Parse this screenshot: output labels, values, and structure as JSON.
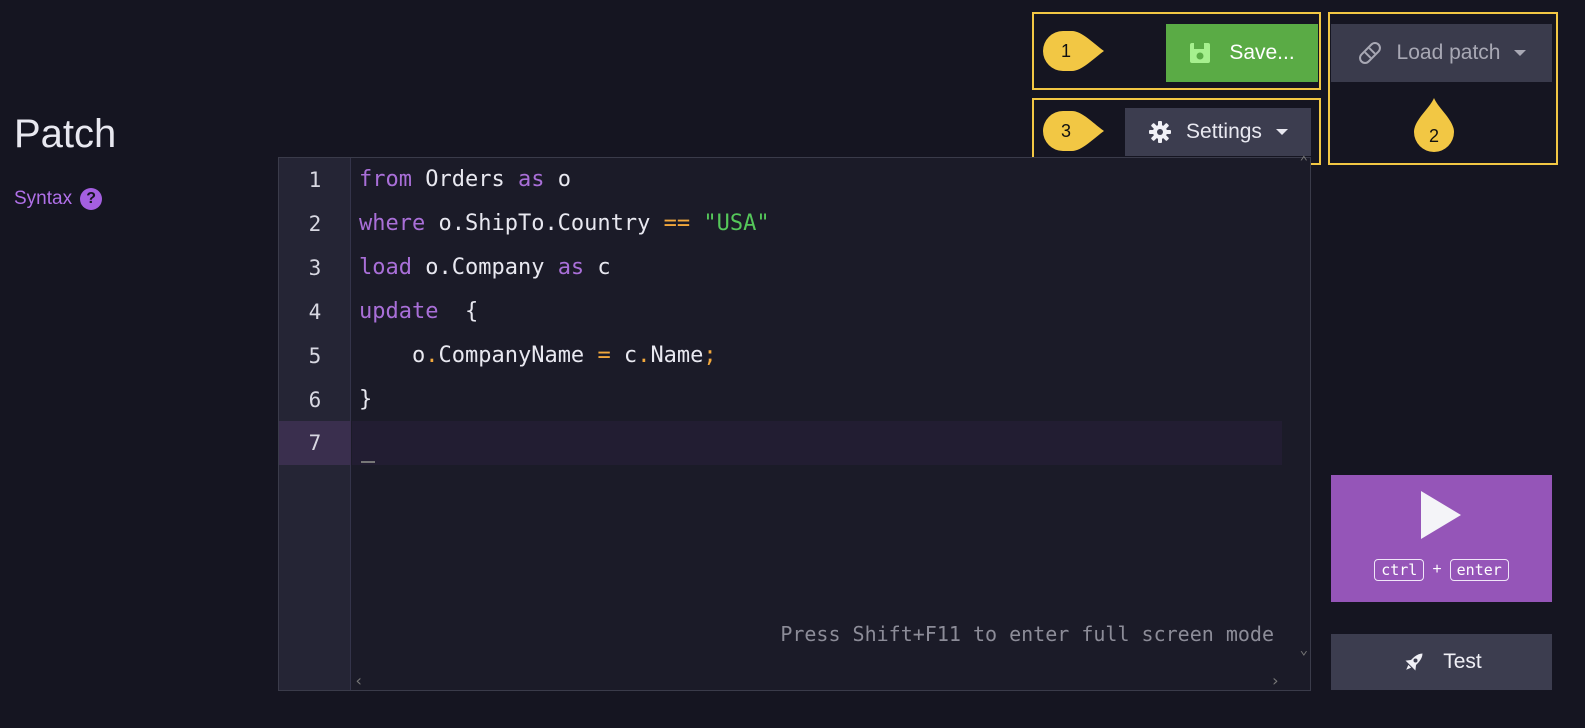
{
  "page": {
    "title": "Patch"
  },
  "syntax": {
    "label": "Syntax",
    "help": "?"
  },
  "callouts": [
    "1",
    "2",
    "3"
  ],
  "toolbar": {
    "save_label": "Save...",
    "load_label": "Load patch",
    "settings_label": "Settings"
  },
  "editor": {
    "line_numbers": [
      "1",
      "2",
      "3",
      "4",
      "5",
      "6",
      "7"
    ],
    "lines": [
      {
        "kw": "from",
        "rest": " Orders ",
        "kw2": "as",
        "tail": " o"
      },
      {
        "kw": "where",
        "rest": " o.ShipTo.Country ",
        "op": "==",
        "str": " \"USA\""
      },
      {
        "kw": "load",
        "rest": " o.Company ",
        "kw2": "as",
        "tail": " c"
      },
      {
        "kw": "update",
        "rest": "  {"
      },
      {
        "pre": "    o",
        "dot1": ".",
        "mid": "CompanyName ",
        "op": "=",
        "mid2": " c",
        "dot2": ".",
        "end": "Name",
        "semi": ";"
      },
      {
        "rest": "}"
      },
      {
        "rest": ""
      }
    ],
    "hint": "Press Shift+F11 to enter full screen mode"
  },
  "run": {
    "key1": "ctrl",
    "plus": "+",
    "key2": "enter"
  },
  "test": {
    "label": "Test"
  },
  "colors": {
    "accent": "#9555b8",
    "save": "#5aab45",
    "callout": "#f2c744"
  }
}
